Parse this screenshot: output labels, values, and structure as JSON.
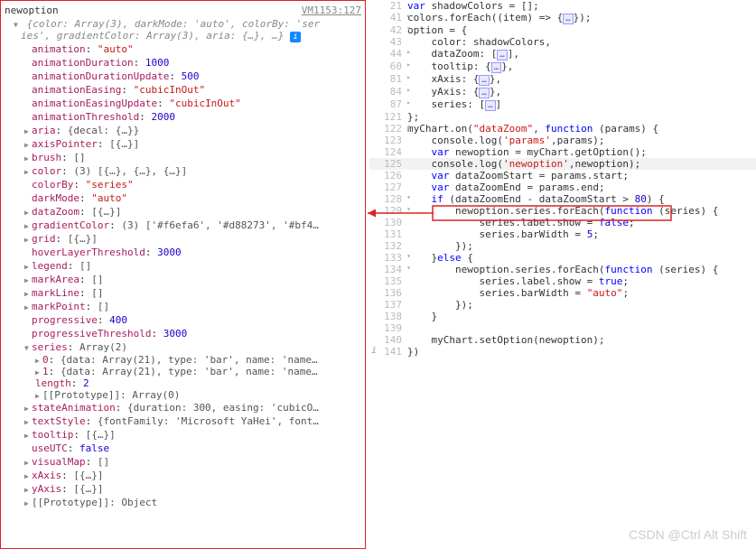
{
  "console": {
    "header": {
      "title": "newoption",
      "source": "VM1153:127"
    },
    "summary_line1": "{color: Array(3), darkMode: 'auto', colorBy: 'ser",
    "summary_line2": "ies', gradientColor: Array(3), aria: {…}, …}",
    "props": [
      {
        "key": "animation",
        "val": "\"auto\"",
        "cls": "str"
      },
      {
        "key": "animationDuration",
        "val": "1000",
        "cls": "num"
      },
      {
        "key": "animationDurationUpdate",
        "val": "500",
        "cls": "num"
      },
      {
        "key": "animationEasing",
        "val": "\"cubicInOut\"",
        "cls": "str"
      },
      {
        "key": "animationEasingUpdate",
        "val": "\"cubicInOut\"",
        "cls": "str"
      },
      {
        "key": "animationThreshold",
        "val": "2000",
        "cls": "num"
      },
      {
        "key": "aria",
        "val": "{decal: {…}}",
        "cls": "gdark",
        "exp": true
      },
      {
        "key": "axisPointer",
        "val": "[{…}]",
        "cls": "gdark",
        "exp": true
      },
      {
        "key": "brush",
        "val": "[]",
        "cls": "gdark",
        "exp": true
      },
      {
        "key": "color",
        "val": "(3) [{…}, {…}, {…}]",
        "cls": "gdark",
        "exp": true
      },
      {
        "key": "colorBy",
        "val": "\"series\"",
        "cls": "str"
      },
      {
        "key": "darkMode",
        "val": "\"auto\"",
        "cls": "str"
      },
      {
        "key": "dataZoom",
        "val": "[{…}]",
        "cls": "gdark",
        "exp": true
      },
      {
        "key": "gradientColor",
        "val": "(3) ['#f6efa6', '#d88273', '#bf4…",
        "cls": "gdark",
        "exp": true
      },
      {
        "key": "grid",
        "val": "[{…}]",
        "cls": "gdark",
        "exp": true
      },
      {
        "key": "hoverLayerThreshold",
        "val": "3000",
        "cls": "num"
      },
      {
        "key": "legend",
        "val": "[]",
        "cls": "gdark",
        "exp": true
      },
      {
        "key": "markArea",
        "val": "[]",
        "cls": "gdark",
        "exp": true
      },
      {
        "key": "markLine",
        "val": "[]",
        "cls": "gdark",
        "exp": true
      },
      {
        "key": "markPoint",
        "val": "[]",
        "cls": "gdark",
        "exp": true
      },
      {
        "key": "progressive",
        "val": "400",
        "cls": "num"
      },
      {
        "key": "progressiveThreshold",
        "val": "3000",
        "cls": "num"
      }
    ],
    "series_hdr": "series: Array(2)",
    "series_items": [
      {
        "idx": "0",
        "val": "{data: Array(21), type: 'bar', name: 'name…"
      },
      {
        "idx": "1",
        "val": "{data: Array(21), type: 'bar', name: 'name…"
      }
    ],
    "series_len": {
      "key": "length",
      "val": "2"
    },
    "series_proto": "[[Prototype]]: Array(0)",
    "props2": [
      {
        "key": "stateAnimation",
        "val": "{duration: 300, easing: 'cubicO…",
        "cls": "gdark",
        "exp": true
      },
      {
        "key": "textStyle",
        "val": "{fontFamily: 'Microsoft YaHei', font…",
        "cls": "gdark",
        "exp": true
      },
      {
        "key": "tooltip",
        "val": "[{…}]",
        "cls": "gdark",
        "exp": true
      },
      {
        "key": "useUTC",
        "val": "false",
        "cls": "bool"
      },
      {
        "key": "visualMap",
        "val": "[]",
        "cls": "gdark",
        "exp": true
      },
      {
        "key": "xAxis",
        "val": "[{…}]",
        "cls": "gdark",
        "exp": true
      },
      {
        "key": "yAxis",
        "val": "[{…}]",
        "cls": "gdark",
        "exp": true
      }
    ],
    "proto": "[[Prototype]]: Object"
  },
  "code": {
    "lines": [
      {
        "ln": 21,
        "html": "<span class='var'>var</span> shadowColors = [];"
      },
      {
        "ln": 41,
        "fold": "▸",
        "html": "colors.forEach((item) =&gt; {<span class='fold-box'>…</span>});"
      },
      {
        "ln": 42,
        "fold": "▾",
        "html": "option = {"
      },
      {
        "ln": 43,
        "html": "    color: shadowColors,"
      },
      {
        "ln": 44,
        "fold": "▸",
        "html": "    dataZoom: [<span class='fold-box'>…</span>],"
      },
      {
        "ln": 60,
        "fold": "▸",
        "html": "    tooltip: {<span class='fold-box'>…</span>},"
      },
      {
        "ln": 81,
        "fold": "▸",
        "html": "    xAxis: {<span class='fold-box'>…</span>},"
      },
      {
        "ln": 84,
        "fold": "▸",
        "html": "    yAxis: {<span class='fold-box'>…</span>},"
      },
      {
        "ln": 87,
        "fold": "▸",
        "html": "    series: [<span class='fold-box'>…</span>]"
      },
      {
        "ln": 121,
        "html": "};"
      },
      {
        "ln": 122,
        "fold": "▾",
        "html": "myChart.on(<span class='str2'>\"dataZoom\"</span>, <span class='kw'>function</span> (params) {"
      },
      {
        "ln": 123,
        "html": "    console.log(<span class='str2'>'params'</span>,params);"
      },
      {
        "ln": 124,
        "html": "    <span class='var'>var</span> newoption = myChart.getOption();"
      },
      {
        "ln": 125,
        "hl": true,
        "html": "    console.log(<span class='str2'>'newoption'</span>,newoption);"
      },
      {
        "ln": 126,
        "html": "    <span class='var'>var</span> dataZoomStart = params.start;"
      },
      {
        "ln": 127,
        "html": "    <span class='var'>var</span> dataZoomEnd = params.end;"
      },
      {
        "ln": 128,
        "fold": "▾",
        "html": "    <span class='kw'>if</span> (dataZoomEnd - dataZoomStart &gt; <span class='num2'>80</span>) {"
      },
      {
        "ln": 129,
        "fold": "▾",
        "html": "        newoption.series.forEach(<span class='kw'>function</span> (series) {"
      },
      {
        "ln": 130,
        "html": "            series.label.show = <span class='kw'>false</span>;"
      },
      {
        "ln": 131,
        "html": "            series.barWidth = <span class='num2'>5</span>;"
      },
      {
        "ln": 132,
        "html": "        });"
      },
      {
        "ln": 133,
        "fold": "▾",
        "html": "    }<span class='kw'>else</span> {"
      },
      {
        "ln": 134,
        "fold": "▾",
        "html": "        newoption.series.forEach(<span class='kw'>function</span> (series) {"
      },
      {
        "ln": 135,
        "html": "            series.label.show = <span class='kw'>true</span>;"
      },
      {
        "ln": 136,
        "html": "            series.barWidth = <span class='str2'>\"auto\"</span>;"
      },
      {
        "ln": 137,
        "html": "        });"
      },
      {
        "ln": 138,
        "html": "    }"
      },
      {
        "ln": 139,
        "html": ""
      },
      {
        "ln": 140,
        "html": "    myChart.setOption(newoption);"
      },
      {
        "ln": 141,
        "imark": "i",
        "html": "})"
      }
    ]
  },
  "watermark": "CSDN @Ctrl Alt Shift"
}
